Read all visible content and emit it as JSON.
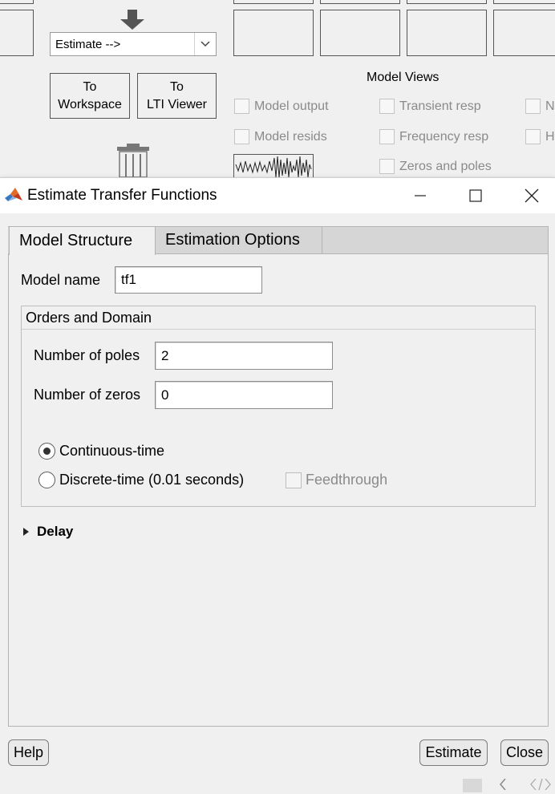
{
  "background_app": {
    "estimate_select": "Estimate -->",
    "to_workspace": "To\nWorkspace",
    "to_lti_viewer": "To\nLTI Viewer",
    "model_views_title": "Model Views",
    "checks": {
      "model_output": "Model output",
      "model_resids": "Model resids",
      "transient_resp": "Transient resp",
      "frequency_resp": "Frequency resp",
      "zeros_and_poles": "Zeros and poles",
      "cut_1": "No",
      "cut_2": "Ha"
    },
    "icons": [
      "down-arrow-icon",
      "trash-icon",
      "chevron-down-icon",
      "waveform-icon"
    ]
  },
  "dialog": {
    "title": "Estimate Transfer Functions",
    "icons": [
      "matlab-logo-icon",
      "minimize-icon",
      "maximize-icon",
      "close-icon"
    ],
    "tabs": [
      "Model Structure",
      "Estimation Options"
    ],
    "active_tab": "Model Structure",
    "model_name_label": "Model name",
    "model_name_value": "tf1",
    "orders_group_title": "Orders and Domain",
    "poles_label": "Number of poles",
    "poles_value": "2",
    "zeros_label": "Number of zeros",
    "zeros_value": "0",
    "continuous_label": "Continuous-time",
    "discrete_label": "Discrete-time (0.01 seconds)",
    "selected_domain": "Continuous-time",
    "feedthrough_label": "Feedthrough",
    "delay_label": "Delay",
    "help_button": "Help",
    "estimate_button": "Estimate",
    "close_button": "Close"
  },
  "colors": {
    "window_bg": "#f0f0f0",
    "titlebar_bg": "#ffffff",
    "tab_inactive_bg": "#d6d6d6",
    "disabled_text": "#8a8a8a"
  }
}
